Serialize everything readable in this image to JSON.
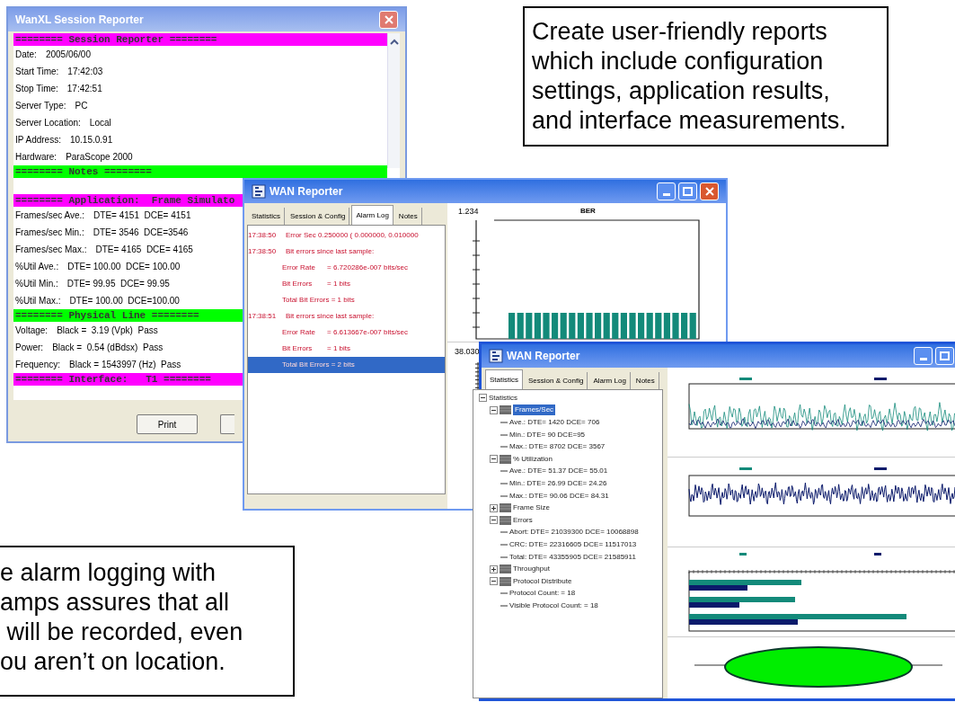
{
  "session_window": {
    "title": "WanXL Session Reporter",
    "sections": [
      {
        "header": "======== Session Reporter ========",
        "color": "#ff00ff",
        "lines": [
          [
            "Date:",
            "2005/06/00"
          ],
          [
            "Start Time:",
            "17:42:03"
          ],
          [
            "Stop Time:",
            "17:42:51"
          ],
          [
            "Server Type:",
            "PC"
          ],
          [
            "Server Location:",
            "Local"
          ],
          [
            "IP Address:",
            "10.15.0.91"
          ],
          [
            "Hardware:",
            "ParaScope 2000"
          ]
        ]
      },
      {
        "header": "======== Notes ========",
        "color": "#00ff00"
      },
      {
        "header": "======== Application:  Frame Simulato",
        "color": "#ff00ff",
        "lines": [
          [
            "Frames/sec Ave.:",
            "DTE= 4151  DCE= 4151"
          ],
          [
            "Frames/sec Min.:",
            "DTE= 3546  DCE=3546"
          ],
          [
            "Frames/sec Max.:",
            "DTE= 4165  DCE= 4165"
          ],
          [
            "%Util Ave.:",
            "DTE= 100.00  DCE= 100.00"
          ],
          [
            "%Util Min.:",
            "DTE= 99.95  DCE= 99.95"
          ],
          [
            "%Util Max.:",
            "DTE= 100.00  DCE=100.00"
          ]
        ]
      },
      {
        "header": "======== Physical Line ========",
        "color": "#00ff00",
        "lines": [
          [
            "Voltage:",
            "Black =  3.19 (Vpk)  Pass"
          ],
          [
            "Power:",
            "Black =  0.54 (dBdsx)  Pass"
          ],
          [
            "Frequency:",
            "Black = 1543997 (Hz)  Pass"
          ]
        ]
      },
      {
        "header": "======== Interface:   T1 ========",
        "color": "#ff00ff"
      }
    ],
    "buttons": [
      "Print"
    ]
  },
  "caption_top": "Create user-friendly reports which include configuration settings, application results, and interface measurements.",
  "alarm_window": {
    "title": "WAN Reporter",
    "tabs": [
      {
        "label": "Statistics",
        "selected": false
      },
      {
        "label": "Session & Config",
        "selected": false
      },
      {
        "label": "Alarm Log",
        "selected": true
      },
      {
        "label": "Notes",
        "selected": false
      }
    ],
    "log": [
      {
        "time": "17:38:50",
        "message": "Error Sec 0.250000 ( 0.000000, 0.010000",
        "selected": false
      },
      {
        "time": "17:38:50",
        "message": "Bit errors since last sample:",
        "selected": false
      },
      {
        "name": "Error Rate",
        "value": "= 6.720286e-007 bits/sec",
        "selected": false
      },
      {
        "name": "Bit Errors",
        "value": "= 1 bits",
        "selected": false
      },
      {
        "message": "Total Bit Errors = 1 bits",
        "indent": true,
        "selected": false
      },
      {
        "time": "17:38:51",
        "message": "Bit errors since last sample:",
        "selected": false
      },
      {
        "name": "Error Rate",
        "value": "= 6.613667e-007 bits/sec",
        "selected": false
      },
      {
        "name": "Bit Errors",
        "value": "= 1 bits",
        "selected": false
      },
      {
        "message": "Total Bit Errors = 2 bits",
        "indent": true,
        "selected": true
      }
    ],
    "ber_chart": {
      "title": "BER",
      "max": "1.234"
    },
    "error_chart": {
      "max": "38.030"
    }
  },
  "stats_window": {
    "title": "WAN Reporter",
    "tabs": [
      {
        "label": "Statistics",
        "selected": true
      },
      {
        "label": "Session & Config",
        "selected": false
      },
      {
        "label": "Alarm Log",
        "selected": false
      },
      {
        "label": "Notes",
        "selected": false
      }
    ],
    "tree": [
      {
        "label": "Statistics",
        "expanded": true,
        "selected": false,
        "children": [
          {
            "label": "Frames/Sec",
            "expanded": true,
            "selected": true,
            "children": [
              {
                "label": "Ave.:  DTE= 1420  DCE= 706",
                "selected": false
              },
              {
                "label": "Min.:  DTE= 90  DCE=95",
                "selected": false
              },
              {
                "label": "Max.:  DTE= 8702  DCE= 3567",
                "selected": false
              }
            ]
          },
          {
            "label": "% Utilization",
            "expanded": true,
            "selected": false,
            "children": [
              {
                "label": "Ave.:  DTE= 51.37  DCE= 55.01",
                "selected": false
              },
              {
                "label": "Min.:  DTE= 26.99  DCE= 24.26",
                "selected": false
              },
              {
                "label": "Max.:  DTE= 90.06  DCE= 84.31",
                "selected": false
              }
            ]
          },
          {
            "label": "Frame Size",
            "expanded": false,
            "selected": false
          },
          {
            "label": "Errors",
            "expanded": true,
            "selected": false,
            "children": [
              {
                "label": "Abort:  DTE= 21039300  DCE= 10068898",
                "selected": false
              },
              {
                "label": "CRC:  DTE= 22316605  DCE= 11517013",
                "selected": false
              },
              {
                "label": "Total:  DTE= 43355905  DCE= 21585911",
                "selected": false
              }
            ]
          },
          {
            "label": "Throughput",
            "expanded": false,
            "selected": false
          },
          {
            "label": "Protocol Distribute",
            "expanded": true,
            "selected": false,
            "children": [
              {
                "label": "Protocol Count:  = 18",
                "selected": false
              },
              {
                "label": "Visible Protocol Count:  = 18",
                "selected": false
              }
            ]
          }
        ]
      }
    ]
  },
  "caption_bottom": [
    "e alarm logging with",
    "amps assures that all",
    " will be recorded, even",
    "ou aren’t on location."
  ]
}
